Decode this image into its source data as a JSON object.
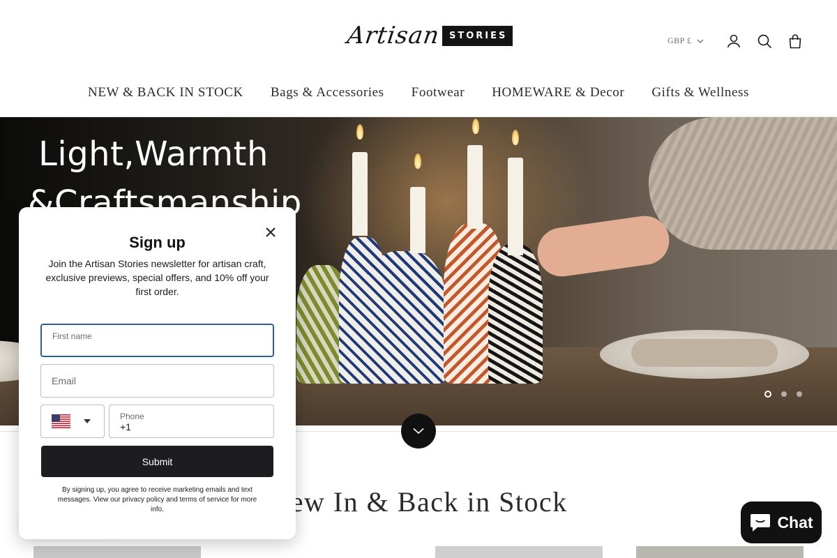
{
  "header": {
    "logo": {
      "script": "Artisan",
      "box": "STORIES"
    },
    "currency": "GBP £",
    "icons": [
      "account-icon",
      "search-icon",
      "cart-icon"
    ]
  },
  "nav": {
    "items": [
      {
        "label": "NEW & BACK IN STOCK"
      },
      {
        "label": "Bags & Accessories"
      },
      {
        "label": "Footwear"
      },
      {
        "label": "HOMEWARE & Decor"
      },
      {
        "label": "Gifts & Wellness"
      }
    ]
  },
  "hero": {
    "title_line1": "Light,Warmth",
    "title_line2": "&Craftsmanship",
    "slides_total": 3,
    "active_slide": 1
  },
  "section": {
    "title": "New In & Back in Stock"
  },
  "popup": {
    "title": "Sign up",
    "description": "Join the Artisan Stories newsletter for artisan craft, exclusive previews, special offers, and 10% off your first order.",
    "first_name_label": "First name",
    "email_placeholder": "Email",
    "phone_label": "Phone",
    "phone_value": "+1",
    "country_flag": "us-flag-icon",
    "submit_label": "Submit",
    "legal": "By signing up, you agree to receive marketing emails and text messages. View our privacy policy and terms of service for more info."
  },
  "chat": {
    "label": "Chat"
  },
  "colors": {
    "focus_border": "#2f5f88",
    "button_dark": "#1d1d1f",
    "text_dark": "#2b2b2b"
  }
}
